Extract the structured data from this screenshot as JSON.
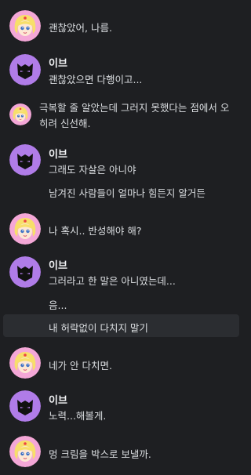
{
  "messages": [
    {
      "id": "m1",
      "author": "",
      "lines": [
        "괜찮았어, 나름."
      ]
    },
    {
      "id": "m2",
      "author": "이브",
      "lines": [
        "괜찮았으면 다행이고..."
      ]
    },
    {
      "id": "m3",
      "author": "",
      "lines": [
        "극복할 줄 알았는데 그러지 못했다는 점에서 오히려 신선해."
      ]
    },
    {
      "id": "m4",
      "author": "이브",
      "lines": [
        "그래도 자살은 아니야",
        "남겨진 사람들이 얼마나 힘든지 알거든"
      ]
    },
    {
      "id": "m5",
      "author": "",
      "lines": [
        "나 혹시.. 반성해야 해?"
      ]
    },
    {
      "id": "m6",
      "author": "이브",
      "lines": [
        "그러라고 한 말은 아니였는데...",
        "음...",
        "내 허락없이 다치지 말기"
      ]
    },
    {
      "id": "m7",
      "author": "",
      "lines": [
        "네가 안 다치면."
      ]
    },
    {
      "id": "m8",
      "author": "이브",
      "lines": [
        "노력...해볼게."
      ]
    },
    {
      "id": "m9",
      "author": "",
      "lines": [
        "멍 크림을 박스로 보낼까."
      ]
    }
  ],
  "colors": {
    "background": "#1e1f22",
    "pink_avatar": "#f4a7d7",
    "purple_avatar": "#b07ce8"
  }
}
